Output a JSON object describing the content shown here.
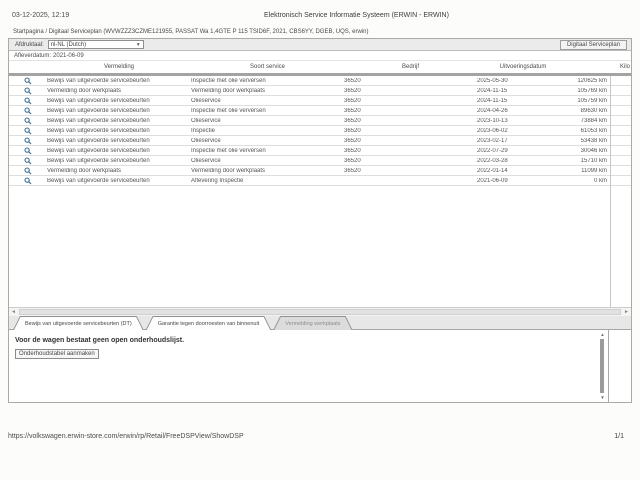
{
  "header": {
    "timestamp": "03-12-2025, 12:19",
    "title": "Elektronisch Service Informatie Systeem (ERWIN - ERWIN)",
    "breadcrumb": "Startpagina / Digitaal Serviceplan (WVWZZZ3CZME121955, PASSAT Wa 1,4GTE P 115 TSID6F, 2021, CBS6YY, DGEB, UQS, erwin)"
  },
  "toolbar": {
    "language_label": "Afdruktaal:",
    "language_value": "nl-NL (Dutch)",
    "serviceplan_button": "Digitaal Serviceplan",
    "delivery_label": "Afleverdatum:",
    "delivery_value": "2021-06-09"
  },
  "table": {
    "headers": {
      "vermelding": "Vermelding",
      "soort": "Soort service",
      "bedrijf": "Bedrijf",
      "datum": "Uitvoeringsdatum",
      "km": "Kilo"
    },
    "rows": [
      {
        "vermelding": "Bewijs van uitgevoerde servicebeurten",
        "soort": "Inspectie met olie verversen",
        "bedrijf": "36520",
        "datum": "2025-05-30",
        "km": "120625 km"
      },
      {
        "vermelding": "Vermelding door werkplaats",
        "soort": "Vermelding door werkplaats",
        "bedrijf": "36520",
        "datum": "2024-11-15",
        "km": "105769 km"
      },
      {
        "vermelding": "Bewijs van uitgevoerde servicebeurten",
        "soort": "Olieservice",
        "bedrijf": "36520",
        "datum": "2024-11-15",
        "km": "105759 km"
      },
      {
        "vermelding": "Bewijs van uitgevoerde servicebeurten",
        "soort": "Inspectie met olie verversen",
        "bedrijf": "36520",
        "datum": "2024-04-26",
        "km": "89630 km"
      },
      {
        "vermelding": "Bewijs van uitgevoerde servicebeurten",
        "soort": "Olieservice",
        "bedrijf": "36520",
        "datum": "2023-10-13",
        "km": "73884 km"
      },
      {
        "vermelding": "Bewijs van uitgevoerde servicebeurten",
        "soort": "Inspectie",
        "bedrijf": "36520",
        "datum": "2023-06-02",
        "km": "61053 km"
      },
      {
        "vermelding": "Bewijs van uitgevoerde servicebeurten",
        "soort": "Olieservice",
        "bedrijf": "36520",
        "datum": "2023-02-17",
        "km": "53438 km"
      },
      {
        "vermelding": "Bewijs van uitgevoerde servicebeurten",
        "soort": "Inspectie met olie verversen",
        "bedrijf": "36520",
        "datum": "2022-07-29",
        "km": "30046 km"
      },
      {
        "vermelding": "Bewijs van uitgevoerde servicebeurten",
        "soort": "Olieservice",
        "bedrijf": "36520",
        "datum": "2022-03-28",
        "km": "15710 km"
      },
      {
        "vermelding": "Vermelding door werkplaats",
        "soort": "Vermelding door werkplaats",
        "bedrijf": "36520",
        "datum": "2022-01-14",
        "km": "11099 km"
      },
      {
        "vermelding": "Bewijs van uitgevoerde servicebeurten",
        "soort": "Aflevering Inspectie",
        "bedrijf": "",
        "datum": "2021-06-09",
        "km": "0 km"
      }
    ]
  },
  "tabs": [
    {
      "label": "Bewijs van uitgevoerde servicebeurten (DT)"
    },
    {
      "label": "Garantie tegen doorroesten van binnenuit"
    },
    {
      "label": "Vermelding werkplaats"
    }
  ],
  "panel": {
    "message": "Voor de wagen bestaat geen open onderhoudslijst.",
    "button_label": "Onderhoudstabel aanmaken"
  },
  "footer": {
    "url": "https://volkswagen.erwin-store.com/erwin/rp/Retail/FreeDSPView/ShowDSP",
    "page_indicator": "1/1"
  },
  "colors": {
    "magnifier_icon": "#3f6f96",
    "toolbar_bg": "#ebebeb",
    "border": "#a9a9a9"
  }
}
